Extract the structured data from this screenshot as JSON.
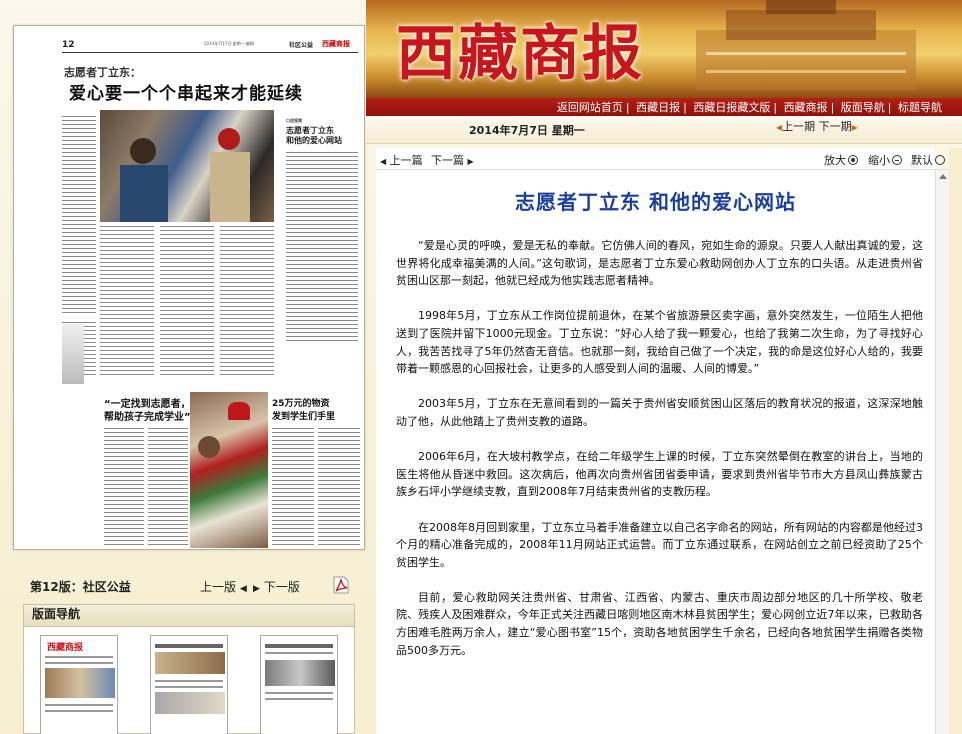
{
  "newspaper_page": {
    "page_number": "12",
    "section": "社区公益",
    "brand": "西藏商报",
    "kicker": "志愿者丁立东：",
    "headline": "爱心要一个个串起来才能延续",
    "box_title": "志愿者丁立东\n和他的爱心网站",
    "box_tag": "口述视频",
    "mid_headline": "“一定找到志愿者，\n帮助孩子完成学业”",
    "right_headline": "25万元的物资\n发到学生们手里"
  },
  "page_nav": {
    "current": "第12版：社区公益",
    "prev": "上一版",
    "next": "下一版",
    "prev_arrow": "◀",
    "next_arrow": "▶"
  },
  "nav_panel": {
    "title": "版面导航"
  },
  "banner": {
    "title": "西藏商报"
  },
  "nav_links": [
    "返回网站首页",
    "西藏日报",
    "西藏日报藏文版",
    "西藏商报",
    "版面导航",
    "标题导航"
  ],
  "date": "2014年7月7日  星期一",
  "issue_nav": {
    "prev": "上一期",
    "next": "下一期"
  },
  "article_toolbar": {
    "prev": "上一篇",
    "next": "下一篇",
    "zoom_in": "放大",
    "zoom_out": "缩小",
    "default": "默认"
  },
  "article": {
    "title": "志愿者丁立东  和他的爱心网站",
    "paragraphs": [
      "“爱是心灵的呼唤，爱是无私的奉献。它仿佛人间的春风，宛如生命的源泉。只要人人献出真诚的爱，这世界将化成幸福美满的人间。”这句歌词，是志愿者丁立东爱心救助网创办人丁立东的口头语。从走进贵州省贫困山区那一刻起，他就已经成为他实践志愿者精神。",
      "1998年5月，丁立东从工作岗位提前退休，在某个省旅游景区卖字画，意外突然发生，一位陌生人把他送到了医院并留下1000元现金。丁立东说：“好心人给了我一颗爱心，也给了我第二次生命，为了寻找好心人，我苦苦找寻了5年仍然杳无音信。也就那一刻，我给自己做了一个决定，我的命是这位好心人给的，我要带着一颗感恩的心回报社会，让更多的人感受到人间的温暖、人间的博爱。”",
      "2003年5月，丁立东在无意间看到的一篇关于贵州省安顺贫困山区落后的教育状况的报道，这深深地触动了他，从此他踏上了贵州支教的道路。",
      "2006年6月，在大坡村教学点，在给二年级学生上课的时候，丁立东突然晕倒在教室的讲台上，当地的医生将他从昏迷中救回。这次病后，他再次向贵州省团省委申请，要求到贵州省毕节市大方县凤山彝族蒙古族乡石坪小学继续支教，直到2008年7月结束贵州省的支教历程。",
      "在2008年8月回到家里，丁立东立马着手准备建立以自己名字命名的网站，所有网站的内容都是他经过3个月的精心准备完成的，2008年11月网站正式运营。而丁立东通过联系，在网站创立之前已经资助了25个贫困学生。",
      "目前，爱心救助网关注贵州省、甘肃省、江西省、内蒙古、重庆市周边部分地区的几十所学校、敬老院、残疾人及困难群众，今年正式关注西藏日喀则地区南木林县贫困学生；爱心网创立近7年以来，已救助各方困难毛胜两万余人，建立“爱心图书室”15个，资助各地贫困学生千余名，已经向各地贫困学生捐赠各类物品500多万元。"
    ]
  },
  "colors": {
    "title_blue": "#1a3fa0",
    "banner_red": "#c8161d",
    "bar_red": "#a0170f"
  }
}
